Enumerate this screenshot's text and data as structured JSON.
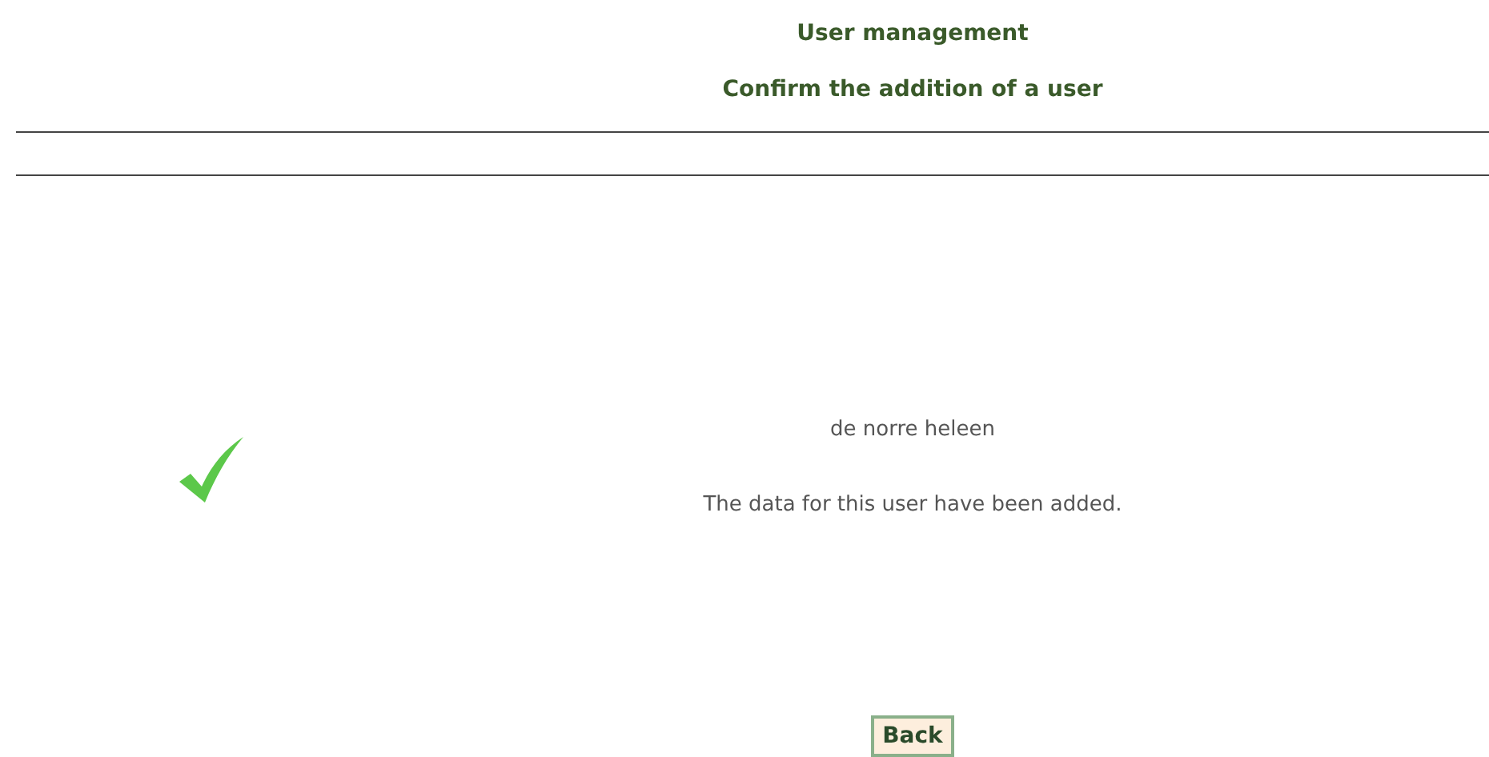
{
  "header": {
    "title": "User management",
    "subtitle": "Confirm the addition of a user"
  },
  "result": {
    "kind": "success",
    "user_name": "de norre heleen",
    "message": "The data for this user have been added."
  },
  "buttons": [
    {
      "label": "Back"
    }
  ]
}
